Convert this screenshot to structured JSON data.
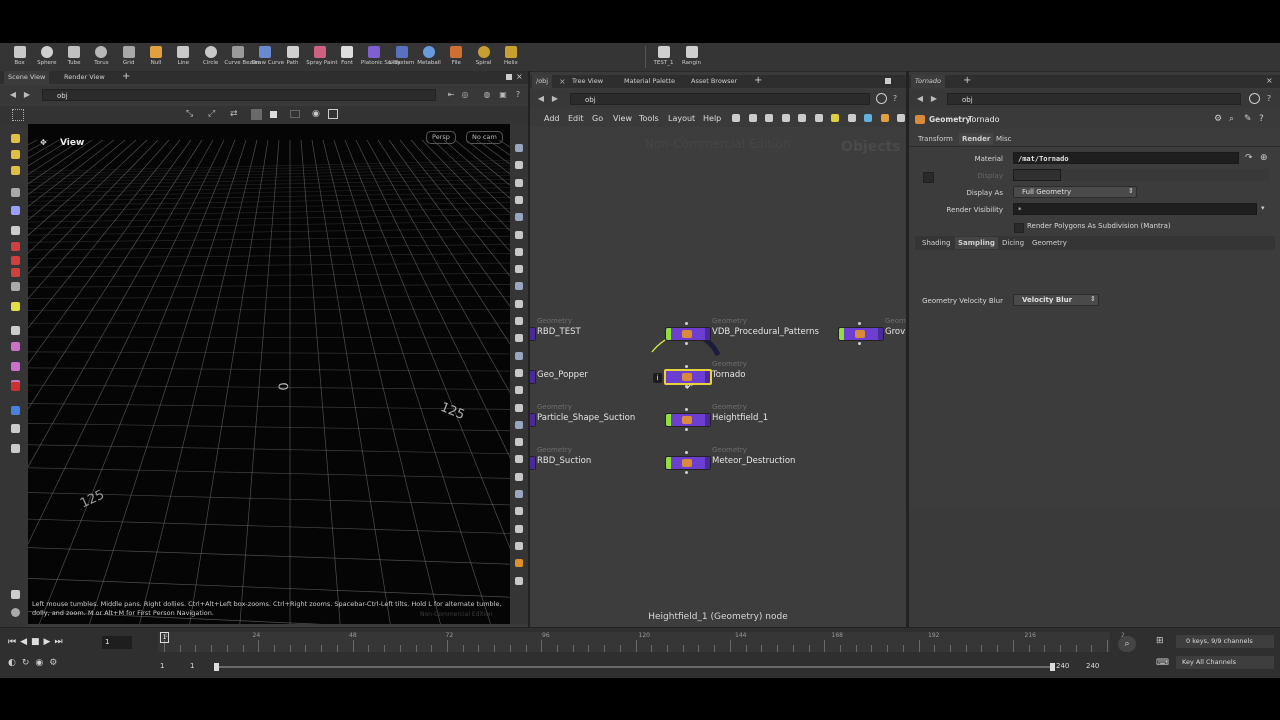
{
  "shelf": {
    "tools": [
      {
        "label": "Box",
        "icon": "box-icon"
      },
      {
        "label": "Sphere",
        "icon": "sphere-icon"
      },
      {
        "label": "Tube",
        "icon": "tube-icon"
      },
      {
        "label": "Torus",
        "icon": "torus-icon"
      },
      {
        "label": "Grid",
        "icon": "grid-icon"
      },
      {
        "label": "Null",
        "icon": "null-icon"
      },
      {
        "label": "Line",
        "icon": "line-icon"
      },
      {
        "label": "Circle",
        "icon": "circle-icon"
      },
      {
        "label": "Curve Bezier",
        "icon": "curve-bezier-icon"
      },
      {
        "label": "Draw Curve",
        "icon": "draw-curve-icon"
      },
      {
        "label": "Path",
        "icon": "path-icon"
      },
      {
        "label": "Spray Paint",
        "icon": "spray-paint-icon"
      },
      {
        "label": "Font",
        "icon": "font-icon"
      },
      {
        "label": "Platonic Solids",
        "icon": "platonic-solids-icon"
      },
      {
        "label": "L-System",
        "icon": "l-system-icon"
      },
      {
        "label": "Metaball",
        "icon": "metaball-icon"
      },
      {
        "label": "File",
        "icon": "file-icon"
      },
      {
        "label": "Spiral",
        "icon": "spiral-icon"
      },
      {
        "label": "Helix",
        "icon": "helix-icon"
      }
    ],
    "extra": [
      {
        "label": "TEST_1",
        "icon": "test-shelf-icon"
      },
      {
        "label": "Rangin",
        "icon": "rangin-shelf-icon"
      }
    ]
  },
  "viewport": {
    "tabs": [
      "Scene View",
      "Render View"
    ],
    "path": "obj",
    "label": "View",
    "persp": "Persp",
    "cam": "No cam",
    "grid_labels": [
      "125",
      "0",
      "125"
    ],
    "hint": "Left mouse tumbles. Middle pans. Right dollies. Ctrl+Alt+Left box-zooms. Ctrl+Right zooms. Spacebar-Ctrl-Left tilts. Hold L for alternate tumble, dolly, and zoom. M or Alt+M for First Person Navigation.",
    "watermark": "Non-Commercial Edition"
  },
  "network": {
    "tabs": [
      "/obj",
      "Tree View",
      "Material Palette",
      "Asset Browser"
    ],
    "path": "obj",
    "menu": [
      "Add",
      "Edit",
      "Go",
      "View",
      "Tools",
      "Layout",
      "Help"
    ],
    "watermark": "Non-Commercial Edition",
    "context": "Objects",
    "nodes": [
      {
        "type": "Geometry",
        "name": "RBD_TEST"
      },
      {
        "type": "Geometry",
        "name": "VDB_Procedural_Patterns"
      },
      {
        "type": "Geom",
        "name": "Grov"
      },
      {
        "type": "",
        "name": "Geo_Popper"
      },
      {
        "type": "Geometry",
        "name": "Tornado"
      },
      {
        "type": "Geometry",
        "name": "Particle_Shape_Suction"
      },
      {
        "type": "Geometry",
        "name": "Heightfield_1"
      },
      {
        "type": "Geometry",
        "name": "RBD_Suction"
      },
      {
        "type": "Geometry",
        "name": "Meteor_Destruction"
      }
    ],
    "info_badge": "i",
    "status": "Heightfield_1 (Geometry) node"
  },
  "params": {
    "tab": "Tornado",
    "path": "obj",
    "node_type": "Geometry",
    "node_name": "Tornado",
    "tabs": [
      "Transform",
      "Render",
      "Misc"
    ],
    "material_label": "Material",
    "material_value": "/mat/Tornado",
    "display_label": "Display",
    "display_as_label": "Display As",
    "display_as_value": "Full Geometry",
    "render_visibility_label": "Render Visibility",
    "render_visibility_value": "*",
    "subdivision_label": "Render Polygons As Subdivision (Mantra)",
    "subtabs": [
      "Shading",
      "Sampling",
      "Dicing",
      "Geometry"
    ],
    "velocity_label": "Geometry Velocity Blur",
    "velocity_value": "Velocity Blur"
  },
  "timeline": {
    "ticks": [
      "1",
      "24",
      "48",
      "72",
      "96",
      "120",
      "144",
      "168",
      "192",
      "216",
      "2"
    ],
    "current_frame": "1",
    "start": "1",
    "start2": "1",
    "end": "240",
    "end2": "240",
    "keys_info": "0 keys, 9/9 channels",
    "key_all": "Key All Channels"
  },
  "colors": {
    "node_purple": "#6d3fd1",
    "display_flag": "#8fe03a",
    "selection": "#e8d23a",
    "grid_line": "#8a8a8a"
  }
}
